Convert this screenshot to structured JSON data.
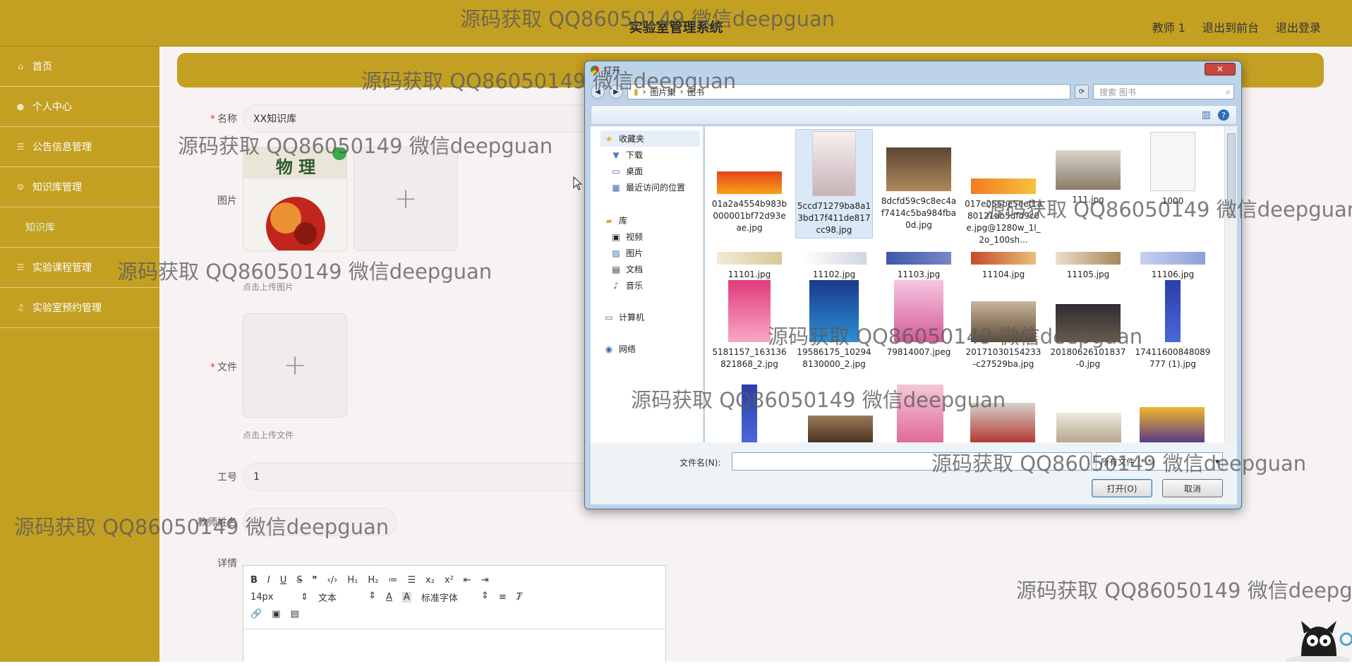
{
  "header": {
    "title": "实验室管理系统",
    "links": [
      "教师 1",
      "退出到前台",
      "退出登录"
    ]
  },
  "sidebar": {
    "items": [
      {
        "label": "首页",
        "icon": "home-icon"
      },
      {
        "label": "个人中心",
        "icon": "user-icon"
      },
      {
        "label": "公告信息管理",
        "icon": "list-icon"
      },
      {
        "label": "知识库管理",
        "icon": "gear-icon"
      },
      {
        "label": "知识库",
        "icon": ""
      },
      {
        "label": "实验课程管理",
        "icon": "list-icon"
      },
      {
        "label": "实验室预约管理",
        "icon": "bell-icon"
      }
    ]
  },
  "form": {
    "name_label": "名称",
    "name_value": "XX知识库",
    "image_label": "图片",
    "image_hint": "点击上传图片",
    "file_label": "文件",
    "file_hint": "点击上传文件",
    "job_no_label": "工号",
    "job_no_value": "1",
    "teacher_label": "教师姓名",
    "details_label": "详情",
    "thumb_title": "物 理"
  },
  "editor": {
    "row1": [
      "B",
      "I",
      "U",
      "S",
      "❞",
      "‹/›",
      "H₁",
      "H₂",
      "≔",
      "☰",
      "x₂",
      "x²",
      "⇤",
      "⇥"
    ],
    "font_size": "14px",
    "text_type": "文本",
    "font_family": "标准字体"
  },
  "dialog": {
    "title": "打开",
    "close_label": "✕",
    "breadcrumb": [
      "图片集",
      "图书"
    ],
    "search_placeholder": "搜索 图书",
    "nav": {
      "favorites": "收藏夹",
      "downloads": "下载",
      "desktop": "桌面",
      "recent": "最近访问的位置",
      "libraries": "库",
      "videos": "视频",
      "pictures": "图片",
      "documents": "文档",
      "music": "音乐",
      "computer": "计算机",
      "network": "网络"
    },
    "files": [
      {
        "name": "01a2a4554b983b000001bf72d93eae.jpg"
      },
      {
        "name": "5ccd71279ba8a13bd17f411de817cc98.jpg"
      },
      {
        "name": "8dcfd59c9c8ec4af7414c5ba984fba0d.jpg"
      },
      {
        "name": "017e055be5eef1a80121ab5dfd9c0e.jpg@1280w_1l_2o_100sh..."
      },
      {
        "name": "111.jpg"
      },
      {
        "name": "1000"
      },
      {
        "name": "11101.jpg"
      },
      {
        "name": "11102.jpg"
      },
      {
        "name": "11103.jpg"
      },
      {
        "name": "11104.jpg"
      },
      {
        "name": "11105.jpg"
      },
      {
        "name": "11106.jpg"
      },
      {
        "name": "5181157_163136821868_2.jpg"
      },
      {
        "name": "19586175_102948130000_2.jpg"
      },
      {
        "name": "79814007.jpeg"
      },
      {
        "name": "20171030154233-c27529ba.jpg"
      },
      {
        "name": "20180626101837-0.jpg"
      },
      {
        "name": "17411600848089777 (1).jpg"
      }
    ],
    "filename_label": "文件名(N):",
    "filetype_value": "所有文件 (*.*)",
    "open_label": "打开(O)",
    "cancel_label": "取消"
  },
  "watermark": "源码获取 QQ86050149 微信deepguan",
  "colors": {
    "theme": "#c4a022",
    "background": "#f7f3f3",
    "accent_submenu": "#dff3d8"
  }
}
